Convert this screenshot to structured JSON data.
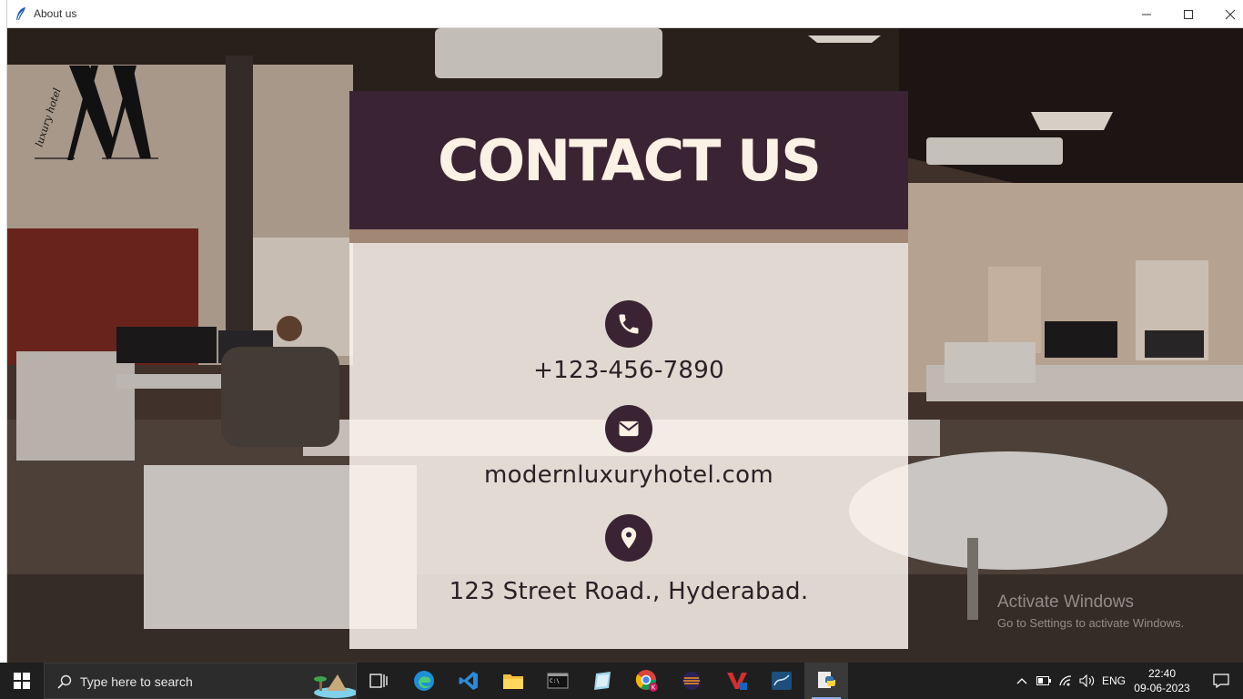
{
  "window": {
    "title": "About us"
  },
  "logo": {
    "script_text": "luxury hotel"
  },
  "contact": {
    "heading": "CONTACT US",
    "phone": "+123-456-7890",
    "website": "modernluxuryhotel.com",
    "address": "123 Street Road., Hyderabad."
  },
  "watermark": {
    "line1": "Activate Windows",
    "line2": "Go to Settings to activate Windows."
  },
  "taskbar": {
    "search_placeholder": "Type here to search",
    "apps": [
      "task-view",
      "edge",
      "vscode",
      "file-explorer",
      "terminal",
      "notes",
      "chrome",
      "eclipse",
      "visual-paradigm",
      "mysql-workbench",
      "python"
    ],
    "language": "ENG",
    "time": "22:40",
    "date": "09-06-2023"
  },
  "colors": {
    "card_header": "#3a2433",
    "card_title": "#fbf1e4",
    "card_strip": "#a18774",
    "card_body": "#faf3ec",
    "icon_circle": "#3a2433",
    "taskbar": "#1f1f1f"
  }
}
